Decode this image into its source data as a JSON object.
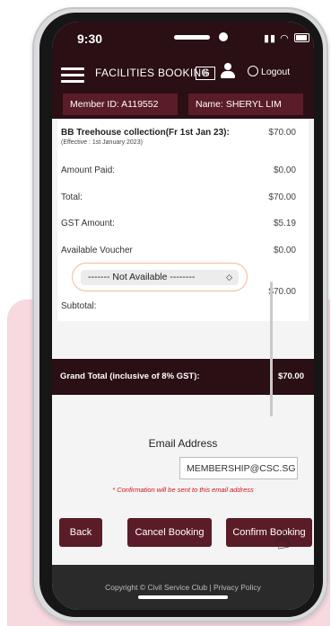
{
  "status_bar": {
    "time": "9:30"
  },
  "app_bar": {
    "title": "FACILITIES BOOKING",
    "logout_label": "Logout"
  },
  "member": {
    "id": "Member ID: A119552",
    "name": "Name: SHERYL LIM"
  },
  "booking": {
    "item": "BB Treehouse collection(Fr 1st Jan 23):",
    "item_price": "$70.00",
    "effective": "(Effective : 1st January 2023)",
    "amount_paid_label": "Amount Paid:",
    "amount_paid": "$0.00",
    "total_label": "Total:",
    "total": "$70.00",
    "gst_label": "GST Amount:",
    "gst": "$5.19",
    "voucher_label": "Available Voucher",
    "voucher_value": "$0.00",
    "voucher_selected": "------- Not Available --------",
    "subtotal_label": "Subtotal:",
    "subtotal": "$70.00"
  },
  "grand_total": {
    "label": "Grand Total (inclusive of 8% GST):",
    "value": "$70.00"
  },
  "email": {
    "label": "Email Address",
    "value": "MEMBERSHIP@CSC.SG",
    "note": "* Confirmation will be sent to this email address"
  },
  "buttons": {
    "back": "Back",
    "cancel": "Cancel Booking",
    "confirm": "Confirm Booking"
  },
  "footer": {
    "text": "Copyright © Civil Service Club | Privacy Policy"
  },
  "colors": {
    "brand": "#2a0f14",
    "button": "#5a1c26",
    "accent": "#f5b996",
    "note": "#d01515"
  }
}
